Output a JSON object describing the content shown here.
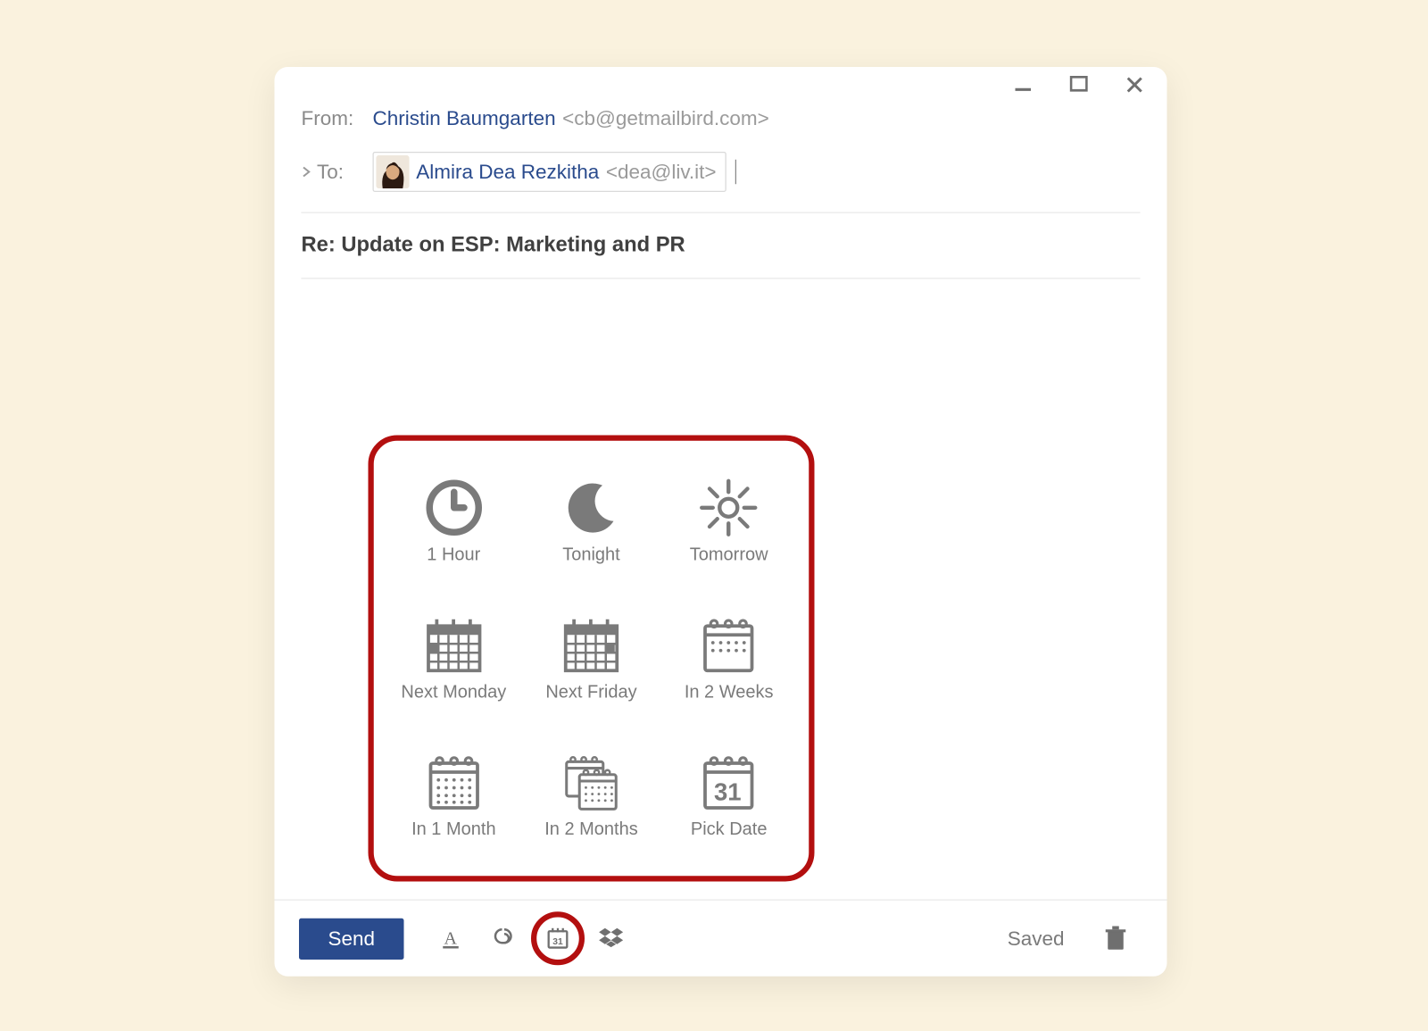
{
  "from": {
    "label": "From:",
    "name": "Christin Baumgarten",
    "email": "<cb@getmailbird.com>"
  },
  "to": {
    "label": "To:",
    "chip_name": "Almira Dea Rezkitha",
    "chip_email": "<dea@liv.it>"
  },
  "subject": "Re: Update on ESP: Marketing and PR",
  "toolbar": {
    "send_label": "Send",
    "saved_label": "Saved"
  },
  "snooze": {
    "options": [
      {
        "icon": "clock",
        "label": "1 Hour"
      },
      {
        "icon": "moon",
        "label": "Tonight"
      },
      {
        "icon": "sun",
        "label": "Tomorrow"
      },
      {
        "icon": "cal-monday",
        "label": "Next Monday"
      },
      {
        "icon": "cal-friday",
        "label": "Next Friday"
      },
      {
        "icon": "cal-2weeks",
        "label": "In 2 Weeks"
      },
      {
        "icon": "cal-1month",
        "label": "In 1 Month"
      },
      {
        "icon": "cal-2months",
        "label": "In 2 Months"
      },
      {
        "icon": "cal-pick",
        "label": "Pick Date"
      }
    ]
  }
}
